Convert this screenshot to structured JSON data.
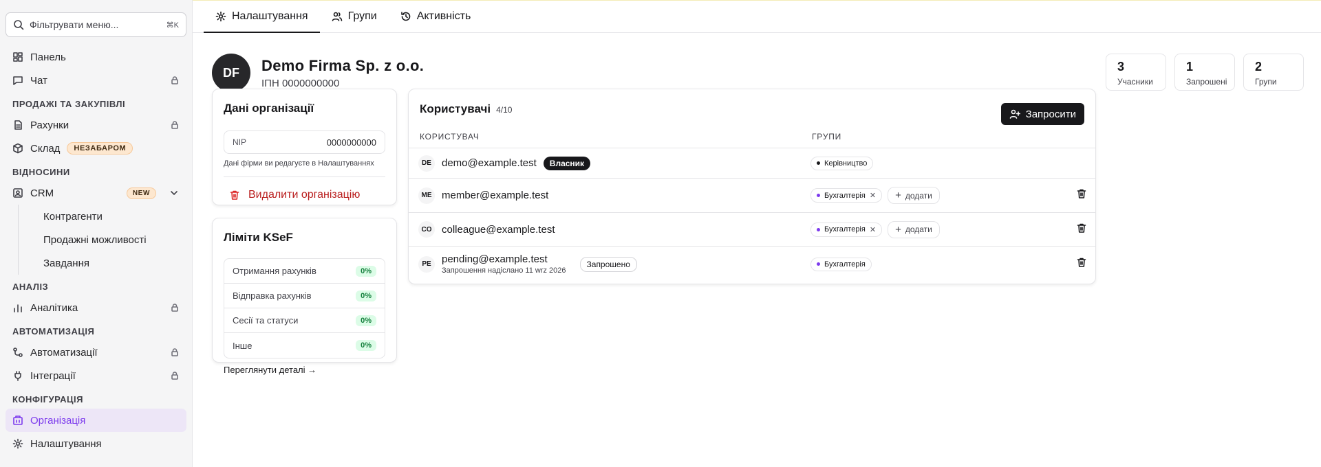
{
  "sidebar": {
    "search_placeholder": "Фільтрувати меню...",
    "search_shortcut": "⌘K",
    "panel": "Панель",
    "chat": "Чат",
    "sections": {
      "sales": "ПРОДАЖІ ТА ЗАКУПІВЛІ",
      "relations": "ВІДНОСИНИ",
      "analysis": "АНАЛІЗ",
      "automation": "АВТОМАТИЗАЦІЯ",
      "config": "КОНФІГУРАЦІЯ"
    },
    "invoices": "Рахунки",
    "warehouse": "Склад",
    "warehouse_badge": "НЕЗАБАРОМ",
    "crm": "CRM",
    "crm_badge": "NEW",
    "crm_sub": [
      "Контрагенти",
      "Продажні можливості",
      "Завдання"
    ],
    "analytics": "Аналітика",
    "automations": "Автоматизації",
    "integrations": "Інтеграції",
    "organization": "Організація",
    "settings": "Налаштування"
  },
  "tabs": [
    "Налаштування",
    "Групи",
    "Активність"
  ],
  "org": {
    "initials": "DF",
    "name": "Demo Firma Sp. z o.o.",
    "tax": "ІПН 0000000000"
  },
  "stats": [
    {
      "value": "3",
      "label": "Учасники"
    },
    {
      "value": "1",
      "label": "Запрошені"
    },
    {
      "value": "2",
      "label": "Групи"
    }
  ],
  "org_data": {
    "title": "Дані організації",
    "nip_label": "NIP",
    "nip_value": "0000000000",
    "hint": "Дані фірми ви редагуєте в Налаштуваннях",
    "delete_label": "Видалити організацію"
  },
  "ksef": {
    "title": "Ліміти KSeF",
    "rows": [
      {
        "label": "Отримання рахунків",
        "value": "0%"
      },
      {
        "label": "Відправка рахунків",
        "value": "0%"
      },
      {
        "label": "Сесії та статуси",
        "value": "0%"
      },
      {
        "label": "Інше",
        "value": "0%"
      }
    ],
    "details_link": "Переглянути деталі →"
  },
  "users": {
    "title": "Користувачі",
    "count": "4/10",
    "invite_label": "Запросити",
    "col_user": "КОРИСТУВАЧ",
    "col_groups": "ГРУПИ",
    "add_label": "додати",
    "rows": [
      {
        "initials": "DE",
        "email": "demo@example.test",
        "badge": "Власник",
        "group": "Керівництво"
      },
      {
        "initials": "ME",
        "email": "member@example.test",
        "group": "Бухгалтерія"
      },
      {
        "initials": "CO",
        "email": "colleague@example.test",
        "group": "Бухгалтерія"
      },
      {
        "initials": "PE",
        "email": "pending@example.test",
        "sub": "Запрошення надіслано 11 wrz 2026",
        "badge": "Запрошено",
        "group": "Бухгалтерія"
      }
    ]
  },
  "colors": {
    "accent": "#7c3aed",
    "danger": "#dc2626",
    "dark": "#18181b"
  }
}
